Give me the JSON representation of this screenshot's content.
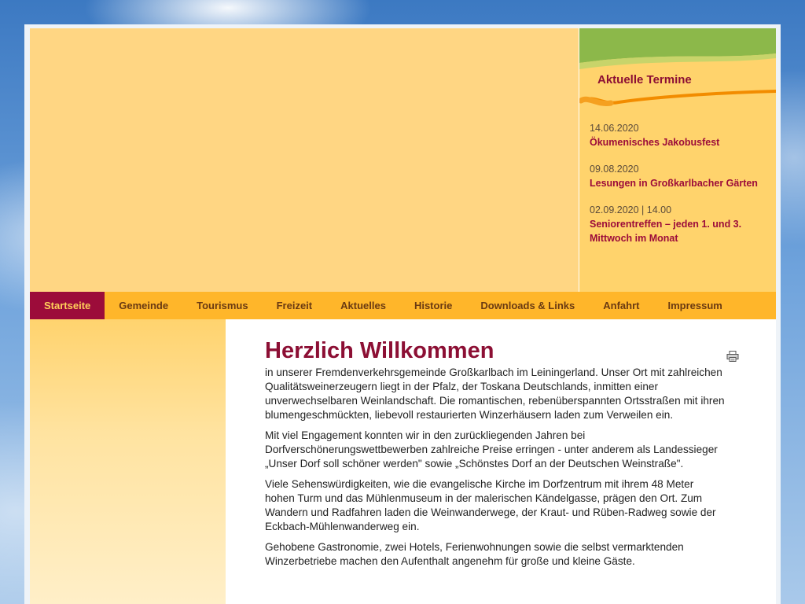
{
  "termine": {
    "title": "Aktuelle Termine",
    "items": [
      {
        "date": "14.06.2020",
        "title": "Ökumenisches Jakobusfest"
      },
      {
        "date": "09.08.2020",
        "title": "Lesungen in Großkarlbacher Gärten"
      },
      {
        "date": "02.09.2020 | 14.00",
        "title": "Seniorentreffen – jeden 1. und 3. Mittwoch im Monat"
      }
    ]
  },
  "nav": {
    "items": [
      {
        "label": "Startseite"
      },
      {
        "label": "Gemeinde"
      },
      {
        "label": "Tourismus"
      },
      {
        "label": "Freizeit"
      },
      {
        "label": "Aktuelles"
      },
      {
        "label": "Historie"
      },
      {
        "label": "Downloads & Links"
      },
      {
        "label": "Anfahrt"
      },
      {
        "label": "Impressum"
      }
    ]
  },
  "main": {
    "title": "Herzlich Willkommen",
    "paragraphs": [
      "in unserer Fremdenverkehrsgemeinde Großkarlbach im Leiningerland. Unser Ort mit zahlreichen Qualitätsweinerzeugern liegt in der Pfalz, der Toskana Deutschlands, inmitten einer unverwechselbaren Weinlandschaft. Die romantischen, rebenüberspannten Ortsstraßen mit ihren blumengeschmückten, liebevoll restaurierten Winzerhäusern laden zum Verweilen ein.",
      "Mit viel Engagement konnten wir in den zurückliegenden Jahren bei Dorfverschönerungswettbewerben zahlreiche Preise erringen - unter anderem als Landessieger „Unser Dorf soll schöner werden\" sowie „Schönstes Dorf an der Deutschen Weinstraße\".",
      "Viele Sehenswürdigkeiten, wie die evangelische Kirche im Dorfzentrum mit ihrem 48 Meter hohen Turm und das Mühlenmuseum in der malerischen Kändelgasse, prägen den Ort. Zum Wandern und Radfahren laden die Weinwanderwege, der Kraut- und Rüben-Radweg sowie der Eckbach-Mühlenwanderweg ein.",
      "Gehobene Gastronomie, zwei Hotels, Ferienwohnungen sowie die selbst vermarktenden Winzerbetriebe machen den Aufenthalt angenehm für große und kleine Gäste."
    ],
    "print_icon": "printer-icon"
  },
  "colors": {
    "accent": "#9c0c3a",
    "nav_bg": "#ffb62a",
    "header_bg": "#ffd683"
  }
}
